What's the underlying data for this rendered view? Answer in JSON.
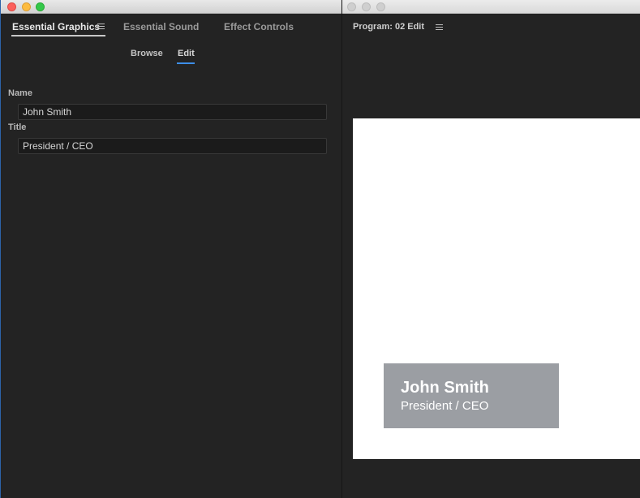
{
  "left_panel": {
    "tabs": [
      {
        "label": "Essential Graphics",
        "active": true
      },
      {
        "label": "Essential Sound",
        "active": false
      },
      {
        "label": "Effect Controls",
        "active": false
      }
    ],
    "subtabs": [
      {
        "label": "Browse",
        "active": false
      },
      {
        "label": "Edit",
        "active": true
      }
    ],
    "fields": [
      {
        "label": "Name",
        "value": "John Smith"
      },
      {
        "label": "Title",
        "value": "President / CEO"
      }
    ]
  },
  "right_panel": {
    "tab_label": "Program: 02 Edit",
    "lower_third": {
      "name": "John Smith",
      "title": "President / CEO"
    }
  },
  "colors": {
    "panel_bg": "#232323",
    "accent_blue": "#3d8ee8",
    "lower_third_bg": "#9b9ea3",
    "monitor_bg": "#ffffff"
  },
  "icons": [
    "panel-menu-icon",
    "close-window-icon",
    "minimize-window-icon",
    "zoom-window-icon"
  ]
}
